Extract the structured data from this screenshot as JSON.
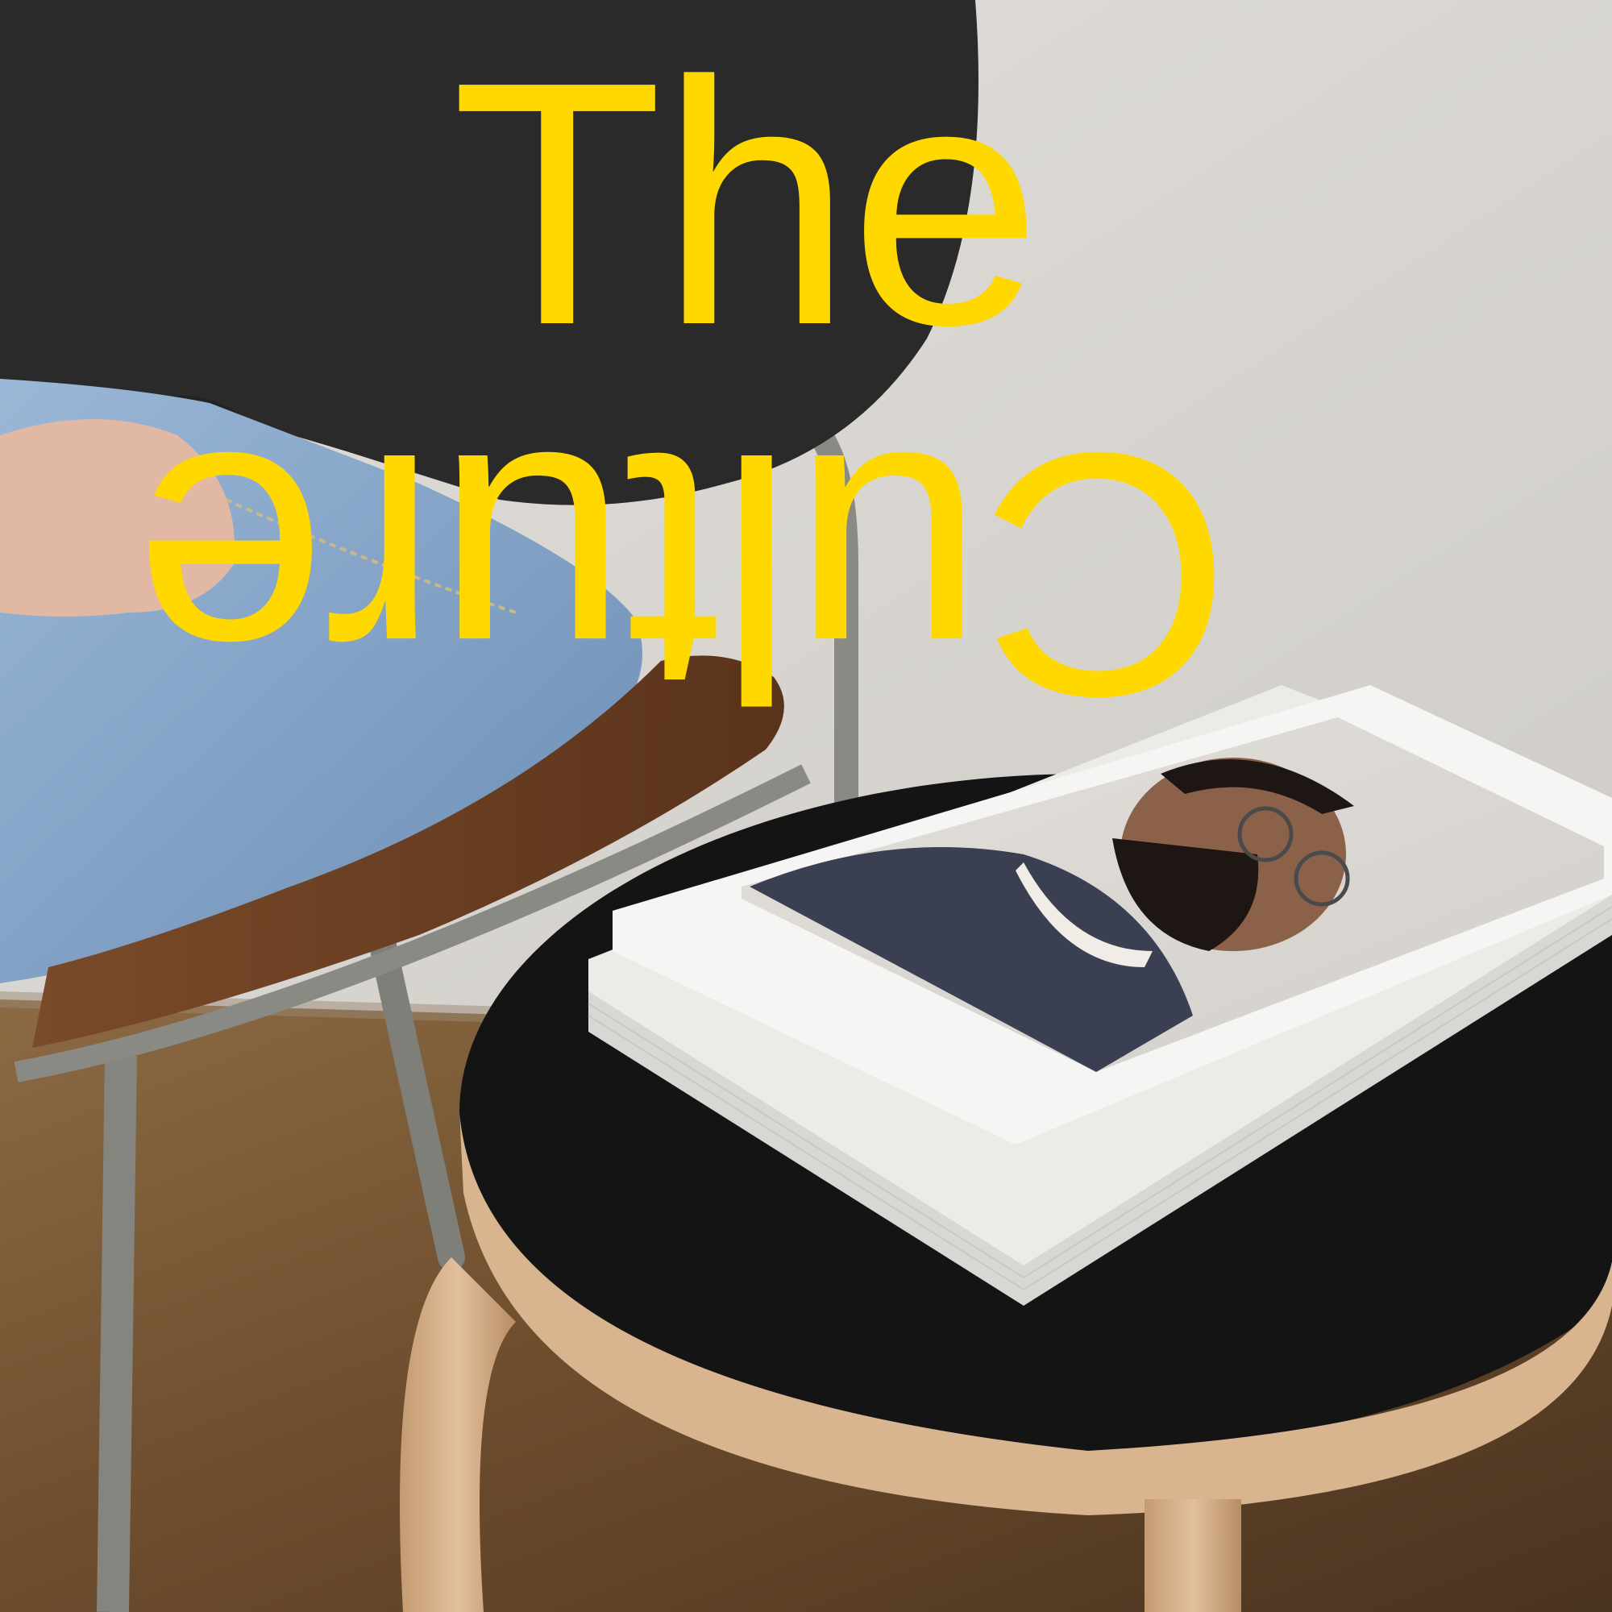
{
  "poster": {
    "title_line_1": "The",
    "title_line_2": "Culture"
  },
  "colors": {
    "title": "#ffd800",
    "wall": "#d9d6d2",
    "floor": "#7a5a3a",
    "sweater": "#2a2a2a",
    "jeans": "#7ea0c4",
    "chair_seat": "#6b3e22",
    "chair_frame": "#8a8a84",
    "stool_top": "#141414",
    "stool_wood": "#d8b48f",
    "magazine_page": "#f3f3f1",
    "portrait_sweater": "#3a3f52"
  }
}
